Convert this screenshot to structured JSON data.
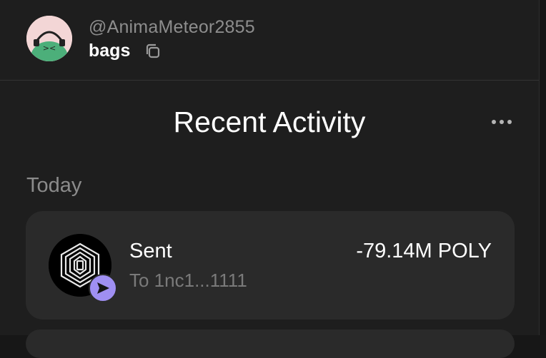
{
  "header": {
    "username": "@AnimaMeteor2855",
    "wallet_name": "bags"
  },
  "activity": {
    "title": "Recent Activity",
    "groups": [
      {
        "label": "Today",
        "items": [
          {
            "type": "Sent",
            "counterparty": "To 1nc1...1111",
            "amount": "-79.14M POLY"
          }
        ]
      }
    ]
  },
  "icons": {
    "copy": "copy-icon",
    "more": "more-horizontal-icon",
    "send_badge": "send-arrow-icon",
    "token_logo": "poly-token-logo"
  },
  "colors": {
    "background": "#1e1e1e",
    "card": "#2a2a2a",
    "muted_text": "#8b8b8b",
    "send_badge": "#9f8ff2",
    "avatar_bg": "#f3d6d6",
    "avatar_body": "#4caf7a"
  }
}
